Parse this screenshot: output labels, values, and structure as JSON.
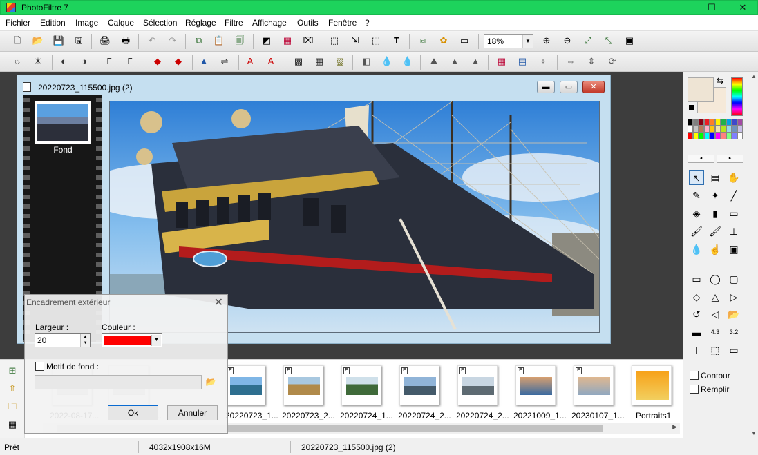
{
  "window": {
    "title": "PhotoFiltre 7",
    "accent": "#1dd35c",
    "minimize_glyph": "—",
    "maximize_glyph": "☐",
    "close_glyph": "✕"
  },
  "menu": [
    "Fichier",
    "Edition",
    "Image",
    "Calque",
    "Sélection",
    "Réglage",
    "Filtre",
    "Affichage",
    "Outils",
    "Fenêtre",
    "?"
  ],
  "toolbar1": {
    "icons": [
      "new-icon",
      "open-icon",
      "save-icon",
      "save-as-icon",
      "print-icon",
      "scan-icon",
      "undo-icon",
      "redo-icon",
      "copy-icon",
      "paste-icon",
      "paste-new-icon",
      "gradient-icon",
      "color-mode-icon",
      "transparency-icon",
      "crop-icon",
      "resize-icon",
      "select-all-icon",
      "text-icon",
      "layers-icon",
      "plugins-icon",
      "window-icon"
    ],
    "glyphs": [
      "🗋",
      "📂",
      "💾",
      "🖫",
      "🖨",
      "🖶",
      "↶",
      "↷",
      "⧉",
      "📋",
      "🗐",
      "◩",
      "▦",
      "⌧",
      "⬚",
      "⇲",
      "⬚",
      "T",
      "⧈",
      "✿",
      "▭"
    ],
    "zoom_value": "18%",
    "zoom_icons": [
      "zoom-in-icon",
      "zoom-out-icon",
      "zoom-fit-icon",
      "zoom-actual-icon",
      "fullscreen-icon"
    ],
    "zoom_glyphs": [
      "⊕",
      "⊖",
      "⤢",
      "⤡",
      "▣"
    ]
  },
  "toolbar2": {
    "icons": [
      "brightness-down-icon",
      "brightness-up-icon",
      "contrast-down-icon",
      "contrast-up-icon",
      "gamma-down-icon",
      "gamma-up-icon",
      "saturation-down-icon",
      "saturation-up-icon",
      "levels-icon",
      "balance-icon",
      "auto-level-icon",
      "auto-contrast-icon",
      "mosaic-icon",
      "pattern-icon",
      "texture-icon",
      "blur-icon",
      "drop-icon",
      "drop-strong-icon",
      "emboss-icon",
      "sharpen-icon",
      "sharpen-strong-icon",
      "color-palette-icon",
      "color-replace-icon",
      "transform-icon",
      "flip-h-icon",
      "flip-v-icon",
      "rotate-icon"
    ],
    "glyphs": [
      "☼",
      "☀",
      "◐",
      "◑",
      "Γ",
      "Γ",
      "◆",
      "◆",
      "▲",
      "⇌",
      "A",
      "A",
      "▩",
      "▦",
      "▧",
      "◧",
      "💧",
      "💧",
      "⛰",
      "▲",
      "▲",
      "▦",
      "▤",
      "⌖",
      "⇔",
      "⇕",
      "⟳"
    ]
  },
  "document": {
    "title": "20220723_115500.jpg (2)",
    "layer_name": "Fond"
  },
  "dialog": {
    "title": "Encadrement extérieur",
    "close_glyph": "✕",
    "width_label": "Largeur :",
    "width_value": "20",
    "color_label": "Couleur :",
    "color_value": "#ff0000",
    "pattern_label": "Motif de fond :",
    "pattern_checked": false,
    "pattern_path": "",
    "ok_label": "Ok",
    "cancel_label": "Annuler"
  },
  "browser": {
    "side_icons": [
      "tree-icon",
      "folder-up-icon",
      "folder-icon",
      "thumbnails-icon"
    ],
    "side_glyphs": [
      "⊞",
      "⇧",
      "🗀",
      "▦"
    ],
    "thumbnails": [
      {
        "label": "2022-08-17...",
        "badge": ""
      },
      {
        "label": "20220723_1...",
        "badge": ""
      },
      {
        "label": "20220723_1...",
        "badge": "E"
      },
      {
        "label": "20220723_2...",
        "badge": "E"
      },
      {
        "label": "20220724_1...",
        "badge": "E"
      },
      {
        "label": "20220724_2...",
        "badge": "E"
      },
      {
        "label": "20220724_2...",
        "badge": "E"
      },
      {
        "label": "20221009_1...",
        "badge": "E"
      },
      {
        "label": "20230107_1...",
        "badge": "E"
      },
      {
        "label": "Portraits1",
        "badge": ""
      }
    ]
  },
  "palette_panel": {
    "fg_color": "#eee4d4",
    "bg_color": "#f5e9d9",
    "swatches": [
      "#000000",
      "#7f7f7f",
      "#880015",
      "#ed1c24",
      "#ff7f27",
      "#fff200",
      "#22b14c",
      "#00a2e8",
      "#3f48cc",
      "#a349a4",
      "#ffffff",
      "#c3c3c3",
      "#b97a57",
      "#ffaec9",
      "#ffc90e",
      "#efe4b0",
      "#b5e61d",
      "#99d9ea",
      "#7092be",
      "#c8bfe7",
      "#ff0000",
      "#ffff00",
      "#00ff00",
      "#00ffff",
      "#0000ff",
      "#ff00ff",
      "#ff8080",
      "#80ff80",
      "#8080ff",
      "#ffffff"
    ],
    "prev_glyph": "◂",
    "next_glyph": "▸",
    "tools": [
      "pointer-tool-icon",
      "layer-manager-icon",
      "hand-tool-icon",
      "eyedropper-icon",
      "magic-wand-icon",
      "line-tool-icon",
      "fill-bucket-icon",
      "spray-icon",
      "eraser-icon",
      "brush-icon",
      "advanced-brush-icon",
      "clone-stamp-icon",
      "blur-drop-icon",
      "finger-icon",
      "image-stamp-icon"
    ],
    "tool_glyphs": [
      "↖",
      "▤",
      "✋",
      "✎",
      "✦",
      "╱",
      "◈",
      "▮",
      "▭",
      "🖌",
      "🖌",
      "⊥",
      "💧",
      "☝",
      "▣"
    ],
    "shapes": [
      "rectangle-shape-icon",
      "ellipse-shape-icon",
      "rounded-rect-shape-icon",
      "diamond-shape-icon",
      "triangle-up-shape-icon",
      "triangle-right-shape-icon",
      "lasso-icon",
      "polygon-icon",
      "open-selection-icon",
      "selection-mode-icon",
      "ratio-43-icon",
      "ratio-32-icon",
      "text-selection-icon",
      "transform-selection-icon",
      "window-selection-icon"
    ],
    "shape_glyphs": [
      "▭",
      "◯",
      "▢",
      "◇",
      "△",
      "▷",
      "↺",
      "◁",
      "📂",
      "▬",
      "4:3",
      "3:2",
      "I",
      "⬚",
      "▭"
    ],
    "contour_label": "Contour",
    "fill_label": "Remplir",
    "contour_checked": false,
    "fill_checked": false
  },
  "status": {
    "state": "Prêt",
    "dimensions": "4032x1908x16M",
    "filename": "20220723_115500.jpg (2)"
  }
}
